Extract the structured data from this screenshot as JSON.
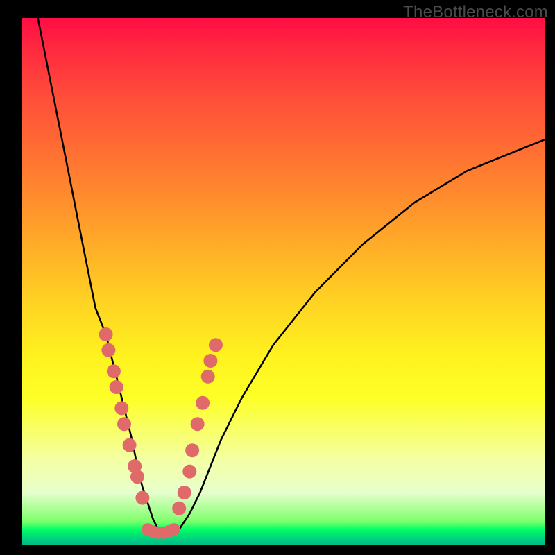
{
  "watermark": "TheBottleneck.com",
  "chart_data": {
    "type": "line",
    "title": "",
    "xlabel": "",
    "ylabel": "",
    "xlim": [
      0,
      100
    ],
    "ylim": [
      0,
      100
    ],
    "curve": {
      "name": "bottleneck-curve",
      "x": [
        3,
        5,
        7,
        9,
        11,
        13,
        14,
        16,
        18,
        19,
        20,
        21,
        22,
        23,
        24,
        25,
        26,
        27,
        28,
        30,
        32,
        34,
        36,
        38,
        40,
        42,
        45,
        48,
        52,
        56,
        60,
        65,
        70,
        75,
        80,
        85,
        90,
        95,
        100
      ],
      "y": [
        100,
        90,
        80,
        70,
        60,
        50,
        45,
        40,
        32,
        28,
        24,
        20,
        15,
        11,
        8,
        5,
        3,
        2,
        2,
        3,
        6,
        10,
        15,
        20,
        24,
        28,
        33,
        38,
        43,
        48,
        52,
        57,
        61,
        65,
        68,
        71,
        73,
        75,
        77
      ]
    },
    "markers_left": {
      "name": "left-branch-points",
      "color": "#e06a6a",
      "points": [
        {
          "x": 16.0,
          "y": 40
        },
        {
          "x": 16.5,
          "y": 37
        },
        {
          "x": 17.5,
          "y": 33
        },
        {
          "x": 18.0,
          "y": 30
        },
        {
          "x": 19.0,
          "y": 26
        },
        {
          "x": 19.5,
          "y": 23
        },
        {
          "x": 20.5,
          "y": 19
        },
        {
          "x": 21.5,
          "y": 15
        },
        {
          "x": 22.0,
          "y": 13
        },
        {
          "x": 23.0,
          "y": 9
        }
      ]
    },
    "markers_right": {
      "name": "right-branch-points",
      "color": "#e06a6a",
      "points": [
        {
          "x": 30.0,
          "y": 7
        },
        {
          "x": 31.0,
          "y": 10
        },
        {
          "x": 32.0,
          "y": 14
        },
        {
          "x": 32.5,
          "y": 18
        },
        {
          "x": 33.5,
          "y": 23
        },
        {
          "x": 34.5,
          "y": 27
        },
        {
          "x": 35.5,
          "y": 32
        },
        {
          "x": 36.0,
          "y": 35
        },
        {
          "x": 37.0,
          "y": 38
        }
      ]
    },
    "markers_bottom": {
      "name": "valley-floor-points",
      "color": "#e06a6a",
      "points": [
        {
          "x": 24.0,
          "y": 3.0
        },
        {
          "x": 25.0,
          "y": 2.6
        },
        {
          "x": 26.0,
          "y": 2.4
        },
        {
          "x": 27.0,
          "y": 2.4
        },
        {
          "x": 28.0,
          "y": 2.6
        },
        {
          "x": 29.0,
          "y": 3.0
        }
      ]
    }
  }
}
